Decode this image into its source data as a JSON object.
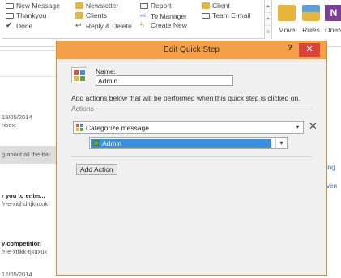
{
  "ribbon": {
    "quick_steps": [
      {
        "label": "New Message",
        "icon": "envelope-icon"
      },
      {
        "label": "Thankyou",
        "icon": "envelope-icon"
      },
      {
        "label": "Done",
        "icon": "checkmark-icon"
      },
      {
        "label": "Newsletter",
        "icon": "folder-icon"
      },
      {
        "label": "Clients",
        "icon": "folder-icon"
      },
      {
        "label": "Reply & Delete",
        "icon": "reply-delete-icon"
      },
      {
        "label": "Report",
        "icon": "envelope-icon"
      },
      {
        "label": "To Manager",
        "icon": "forward-icon"
      },
      {
        "label": "Create New",
        "icon": "lightning-icon"
      },
      {
        "label": "Client",
        "icon": "folder-icon"
      },
      {
        "label": "Team E-mail",
        "icon": "envelope-icon"
      }
    ],
    "buttons": [
      {
        "label": "Move",
        "icon": "move-folder-icon"
      },
      {
        "label": "Rules",
        "icon": "rules-icon"
      },
      {
        "label": "OneN",
        "icon": "onenote-icon"
      }
    ]
  },
  "mail_list": {
    "items": [
      {
        "date": "19/05/2014",
        "preview": "nbox."
      },
      {
        "preview": "g about all the trai"
      },
      {
        "subject": "r you to enter...",
        "preview": "/r-e-xitjhd-tjkuxuk"
      },
      {
        "subject": "y competition",
        "preview": "/r-e-xtiikk-tjkuxuk"
      },
      {
        "date": "12/05/2014"
      }
    ]
  },
  "right_strip": {
    "items": [
      "ing",
      "ven"
    ]
  },
  "dialog": {
    "title": "Edit Quick Step",
    "help_label": "?",
    "close_label": "✕",
    "name_label_prefix": "N",
    "name_label_rest": "ame:",
    "name_value": "Admin",
    "instructions": "Add actions below that will be performed when this quick step is clicked on.",
    "actions_label": "Actions",
    "action_select_value": "Categorize message",
    "remove_label": "✕",
    "category_value": "Admin",
    "add_action_prefix": "A",
    "add_action_rest": "dd Action",
    "colors": {
      "accent": "#f3a048",
      "selection": "#3a8fe0",
      "category": "#6a9f3a"
    }
  }
}
